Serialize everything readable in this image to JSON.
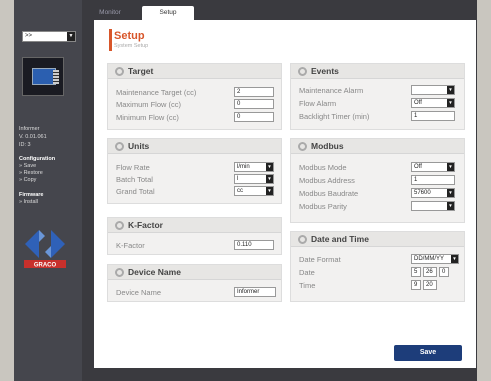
{
  "sidebar": {
    "select_value": ">>",
    "device_name": "Informer",
    "version": "V. 0.01.061",
    "id": "ID: 3",
    "configuration_heading": "Configuration",
    "config_links": [
      "» Save",
      "» Restore",
      "» Copy"
    ],
    "firmware_heading": "Firmware",
    "firmware_links": [
      "» Install"
    ],
    "logo_text": "GRACO"
  },
  "tabs": {
    "monitor": "Monitor",
    "setup": "Setup"
  },
  "header": {
    "title": "Setup",
    "subtitle": "System Setup"
  },
  "target": {
    "title": "Target",
    "rows": [
      {
        "label": "Maintenance Target (cc)",
        "value": "2"
      },
      {
        "label": "Maximum Flow (cc)",
        "value": "0"
      },
      {
        "label": "Minimum Flow (cc)",
        "value": "0"
      }
    ]
  },
  "units": {
    "title": "Units",
    "rows": [
      {
        "label": "Flow Rate",
        "value": "l/min"
      },
      {
        "label": "Batch Total",
        "value": "l"
      },
      {
        "label": "Grand Total",
        "value": "cc"
      }
    ]
  },
  "kfactor": {
    "title": "K-Factor",
    "label": "K-Factor",
    "value": "0.110"
  },
  "device_name": {
    "title": "Device Name",
    "label": "Device Name",
    "value": "Informer"
  },
  "events": {
    "title": "Events",
    "rows": [
      {
        "label": "Maintenance Alarm",
        "value": ""
      },
      {
        "label": "Flow Alarm",
        "value": "Off"
      },
      {
        "label": "Backlight Timer (min)",
        "value": "1"
      }
    ]
  },
  "modbus": {
    "title": "Modbus",
    "rows": [
      {
        "label": "Modbus Mode",
        "value": "Off"
      },
      {
        "label": "Modbus Address",
        "value": "1"
      },
      {
        "label": "Modbus Baudrate",
        "value": "57600"
      },
      {
        "label": "Modbus Parity",
        "value": ""
      }
    ]
  },
  "datetime": {
    "title": "Date and Time",
    "format_label": "Date Format",
    "format_value": "DD/MM/YY",
    "date_label": "Date",
    "date_parts": [
      "5",
      "26",
      "0"
    ],
    "time_label": "Time",
    "time_parts": [
      "9",
      "20"
    ]
  },
  "save_label": "Save",
  "colors": {
    "accent": "#d8562a",
    "save_button": "#1d3d7a",
    "sidebar": "#45464d"
  }
}
